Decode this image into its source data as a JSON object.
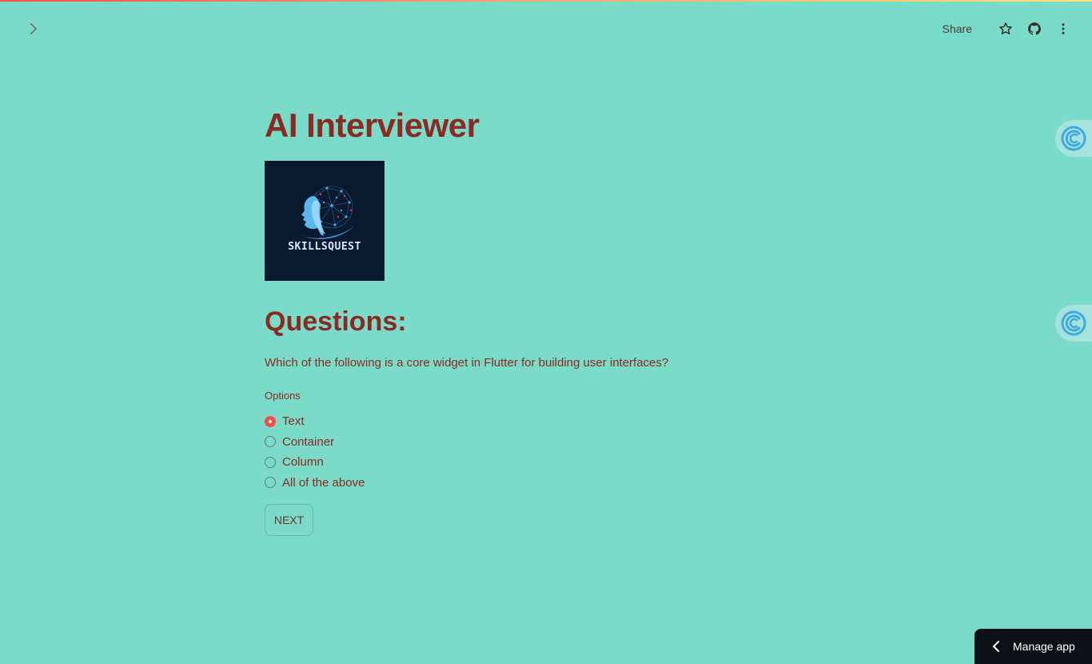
{
  "header": {
    "share_label": "Share",
    "icons": [
      "chevron-right-icon",
      "star-icon",
      "github-icon",
      "more-vertical-icon"
    ]
  },
  "main": {
    "title": "AI Interviewer",
    "logo_text": "SKILLSQUEST",
    "section_heading": "Questions:",
    "question": "Which of the following is a core widget in Flutter for building user interfaces?",
    "options_label": "Options",
    "options": [
      "Text",
      "Container",
      "Column",
      "All of the above"
    ],
    "selected_option": "Text",
    "next_label": "NEXT"
  },
  "footer": {
    "manage_app_label": "Manage app"
  },
  "colors": {
    "background": "#7adbc9",
    "text": "#8b2a22",
    "accent": "#ff4b4b",
    "manage_app_bg": "#0e1117"
  }
}
